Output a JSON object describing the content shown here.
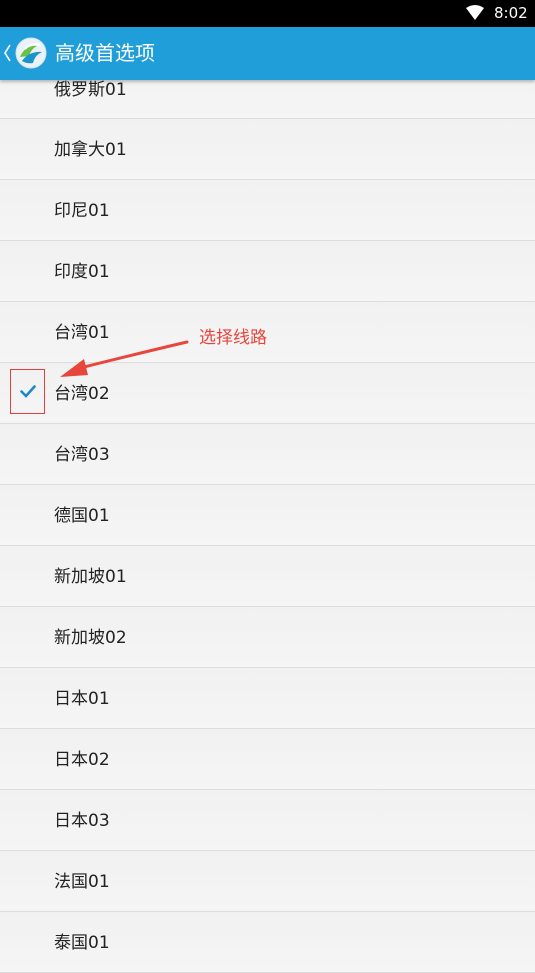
{
  "status_bar": {
    "time": "8:02",
    "wifi_icon": "wifi-icon"
  },
  "app_bar": {
    "title": "高级首选项",
    "back_icon": "chevron-left-icon",
    "logo_icon": "app-logo-icon",
    "color": "#1f9ed9"
  },
  "routes": [
    {
      "label": "俄罗斯01",
      "selected": false
    },
    {
      "label": "加拿大01",
      "selected": false
    },
    {
      "label": "印尼01",
      "selected": false
    },
    {
      "label": "印度01",
      "selected": false
    },
    {
      "label": "台湾01",
      "selected": false
    },
    {
      "label": "台湾02",
      "selected": true
    },
    {
      "label": "台湾03",
      "selected": false
    },
    {
      "label": "德国01",
      "selected": false
    },
    {
      "label": "新加坡01",
      "selected": false
    },
    {
      "label": "新加坡02",
      "selected": false
    },
    {
      "label": "日本01",
      "selected": false
    },
    {
      "label": "日本02",
      "selected": false
    },
    {
      "label": "日本03",
      "selected": false
    },
    {
      "label": "法国01",
      "selected": false
    },
    {
      "label": "泰国01",
      "selected": false
    }
  ],
  "annotation": {
    "text": "选择线路",
    "color": "#e8453c"
  },
  "check_color": "#1e88c7"
}
